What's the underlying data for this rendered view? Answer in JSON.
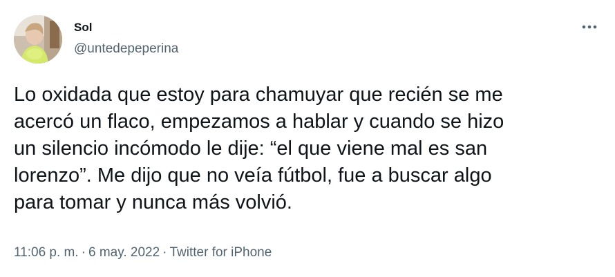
{
  "author": {
    "name": "Sol",
    "handle": "@untedepeperina",
    "avatar_icon": "profile-photo"
  },
  "menu": {
    "icon": "more-options-icon"
  },
  "tweet": {
    "lines": [
      "Lo oxidada que estoy para chamuyar que recién se me",
      "acercó un flaco, empezamos a hablar y cuando se hizo",
      "un silencio incómodo le dije: “el que viene mal es san",
      "lorenzo”. Me dijo que no veía fútbol, fue a buscar algo",
      "para tomar y nunca más volvió."
    ]
  },
  "meta": {
    "time": "11:06 p. m.",
    "separator": "·",
    "date": "6 may. 2022",
    "source": "Twitter for iPhone"
  },
  "colors": {
    "text_primary": "#0f1419",
    "text_secondary": "#536471",
    "background": "#ffffff"
  }
}
